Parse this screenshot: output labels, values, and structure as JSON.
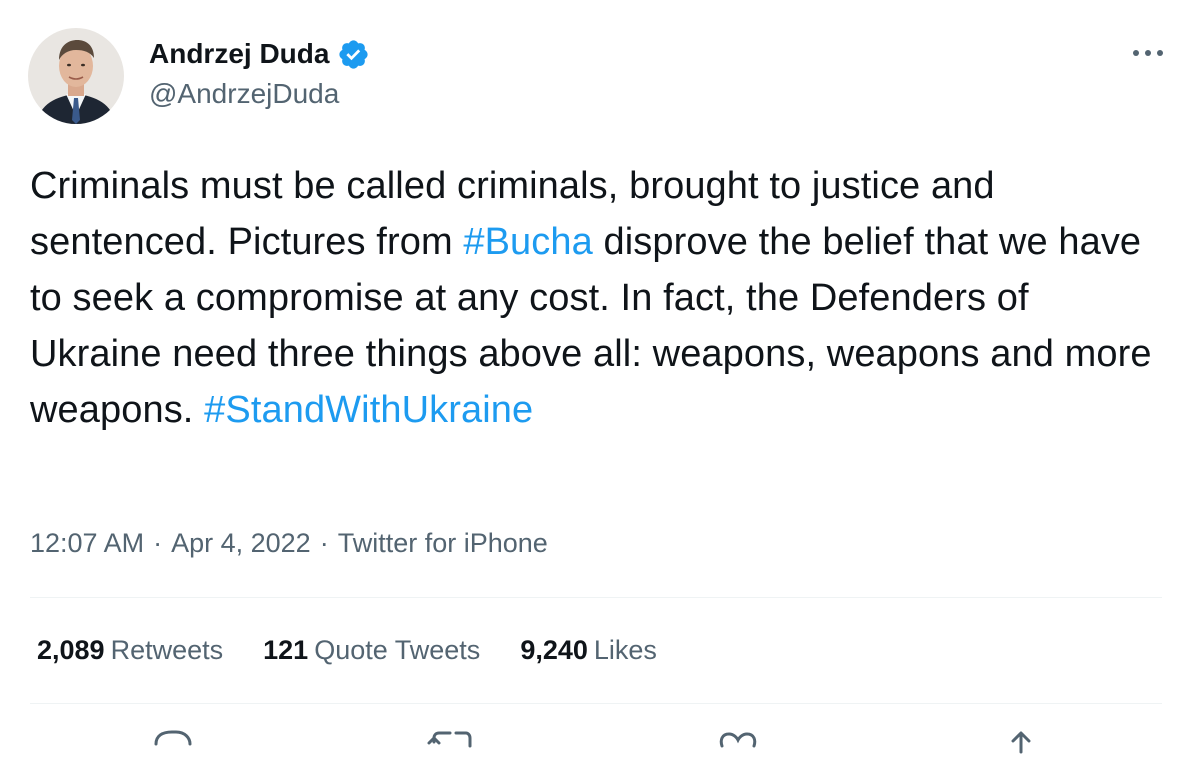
{
  "author": {
    "display_name": "Andrzej Duda",
    "handle": "@AndrzejDuda",
    "verified": true,
    "avatar_icon": "profile-photo"
  },
  "more_icon": "more-horizontal-icon",
  "tweet": {
    "segments": [
      {
        "text": "Criminals must be called criminals, brought to justice and sentenced. Pictures from "
      },
      {
        "text": "#Bucha"
      },
      {
        "text": " disprove the belief that we have to seek a compromise at any cost. In fact, the Defenders of Ukraine need three things above all: weapons, weapons and more weapons. "
      },
      {
        "text": "#StandWithUkraine"
      }
    ]
  },
  "meta": {
    "time": "12:07 AM",
    "separator": "·",
    "date": "Apr 4, 2022",
    "source": "Twitter for iPhone"
  },
  "stats": {
    "retweets": {
      "count": "2,089",
      "label": "Retweets"
    },
    "quotes": {
      "count": "121",
      "label": "Quote Tweets"
    },
    "likes": {
      "count": "9,240",
      "label": "Likes"
    }
  },
  "colors": {
    "text": "#0f1419",
    "secondary": "#536471",
    "accent": "#1d9bf0",
    "divider": "#eff3f4"
  },
  "action_icons": [
    "reply-icon",
    "retweet-icon",
    "like-icon",
    "share-icon"
  ]
}
